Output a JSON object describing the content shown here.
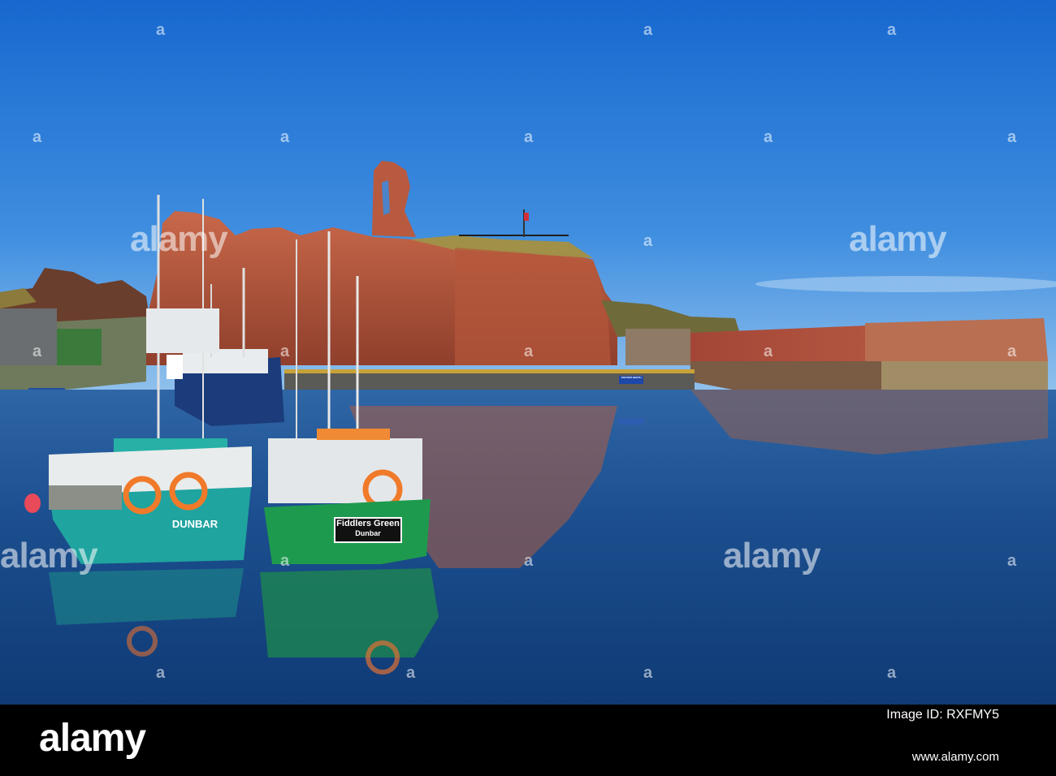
{
  "photo": {
    "boat_left": {
      "name": "DUNBAR"
    },
    "boat_right": {
      "name": "Fiddlers Green",
      "port": "Dunbar"
    },
    "sign": {
      "text": "VISITORS BERTH"
    }
  },
  "watermark": {
    "text": "alamy",
    "leaf": "a"
  },
  "footer": {
    "logo": "alamy",
    "image_id": "Image ID: RXFMY5",
    "url": "www.alamy.com"
  },
  "colors": {
    "sky_top": "#1a6fd2",
    "sky_bottom": "#7fb6ea",
    "water": "#1a4f8c",
    "castle": "#b95a3d",
    "boat_teal": "#1fa7a2",
    "boat_green": "#1e9a4e",
    "footer": "#000000"
  }
}
